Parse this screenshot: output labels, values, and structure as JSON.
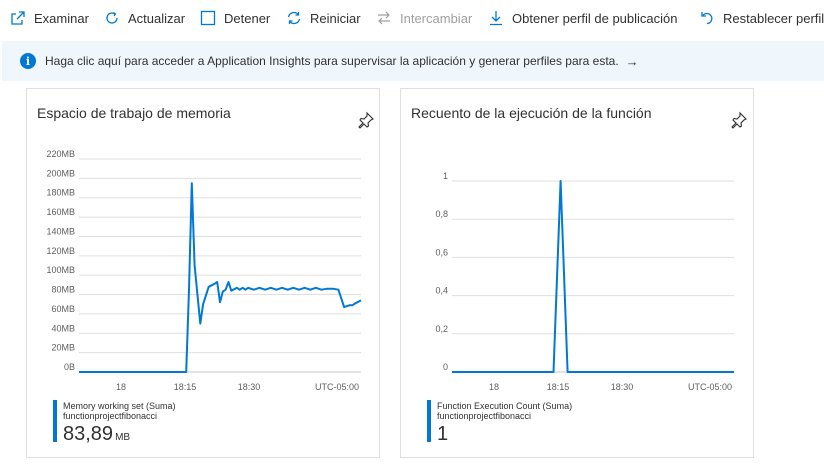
{
  "toolbar": {
    "browse": "Examinar",
    "refresh": "Actualizar",
    "stop": "Detener",
    "restart": "Reiniciar",
    "swap": "Intercambiar",
    "publish_profile": "Obtener perfil de publicación",
    "reset": "Restablecer perfil"
  },
  "banner": {
    "text": "Haga clic aquí para acceder a Application Insights para supervisar la aplicación y generar perfiles para esta.",
    "arrow": "→"
  },
  "memory_card": {
    "title": "Espacio de trabajo de memoria",
    "legend_metric": "Memory working set (Suma)",
    "legend_resource": "functionprojectfibonacci",
    "legend_value": "83,89",
    "legend_unit": "MB"
  },
  "exec_card": {
    "title": "Recuento de la ejecución de la función",
    "legend_metric": "Function Execution Count (Suma)",
    "legend_resource": "functionprojectfibonacci",
    "legend_value": "1"
  },
  "colors": {
    "accent": "#0078d4",
    "grid": "#e1dfdd"
  },
  "chart_data": [
    {
      "type": "line",
      "title": "Espacio de trabajo de memoria",
      "y_ticks": [
        "0B",
        "20MB",
        "40MB",
        "60MB",
        "80MB",
        "100MB",
        "120MB",
        "140MB",
        "160MB",
        "180MB",
        "200MB",
        "220MB"
      ],
      "x_ticks": [
        "18",
        "18:15",
        "18:30",
        "UTC-05:00"
      ],
      "ylim": [
        0,
        220
      ],
      "x": [
        0,
        0.38,
        0.39,
        0.4,
        0.41,
        0.43,
        0.44,
        0.46,
        0.48,
        0.49,
        0.5,
        0.51,
        0.52,
        0.53,
        0.54,
        0.56,
        0.57,
        0.58,
        0.59,
        0.6,
        0.62,
        0.64,
        0.66,
        0.68,
        0.7,
        0.72,
        0.74,
        0.76,
        0.78,
        0.8,
        0.82,
        0.84,
        0.86,
        0.88,
        0.9,
        0.92,
        0.93,
        0.94,
        0.96,
        0.97,
        0.98,
        1.0
      ],
      "values": [
        0,
        0,
        85,
        195,
        110,
        50,
        70,
        88,
        91,
        93,
        72,
        83,
        85,
        93,
        84,
        87,
        85,
        87,
        85,
        87,
        85,
        87,
        85,
        87,
        85,
        87,
        85,
        87,
        85,
        87,
        85,
        87,
        85,
        86,
        86,
        85,
        76,
        67,
        69,
        69,
        71,
        74
      ],
      "grid": true
    },
    {
      "type": "line",
      "title": "Recuento de la ejecución de la función",
      "y_ticks": [
        "0",
        "0,2",
        "0,4",
        "0,6",
        "0,8",
        "1"
      ],
      "x_ticks": [
        "18",
        "18:15",
        "18:30",
        "UTC-05:00"
      ],
      "ylim": [
        0,
        1
      ],
      "x": [
        0,
        0.36,
        0.385,
        0.41,
        1.0
      ],
      "values": [
        0,
        0,
        1,
        0,
        0
      ],
      "grid": true
    }
  ]
}
